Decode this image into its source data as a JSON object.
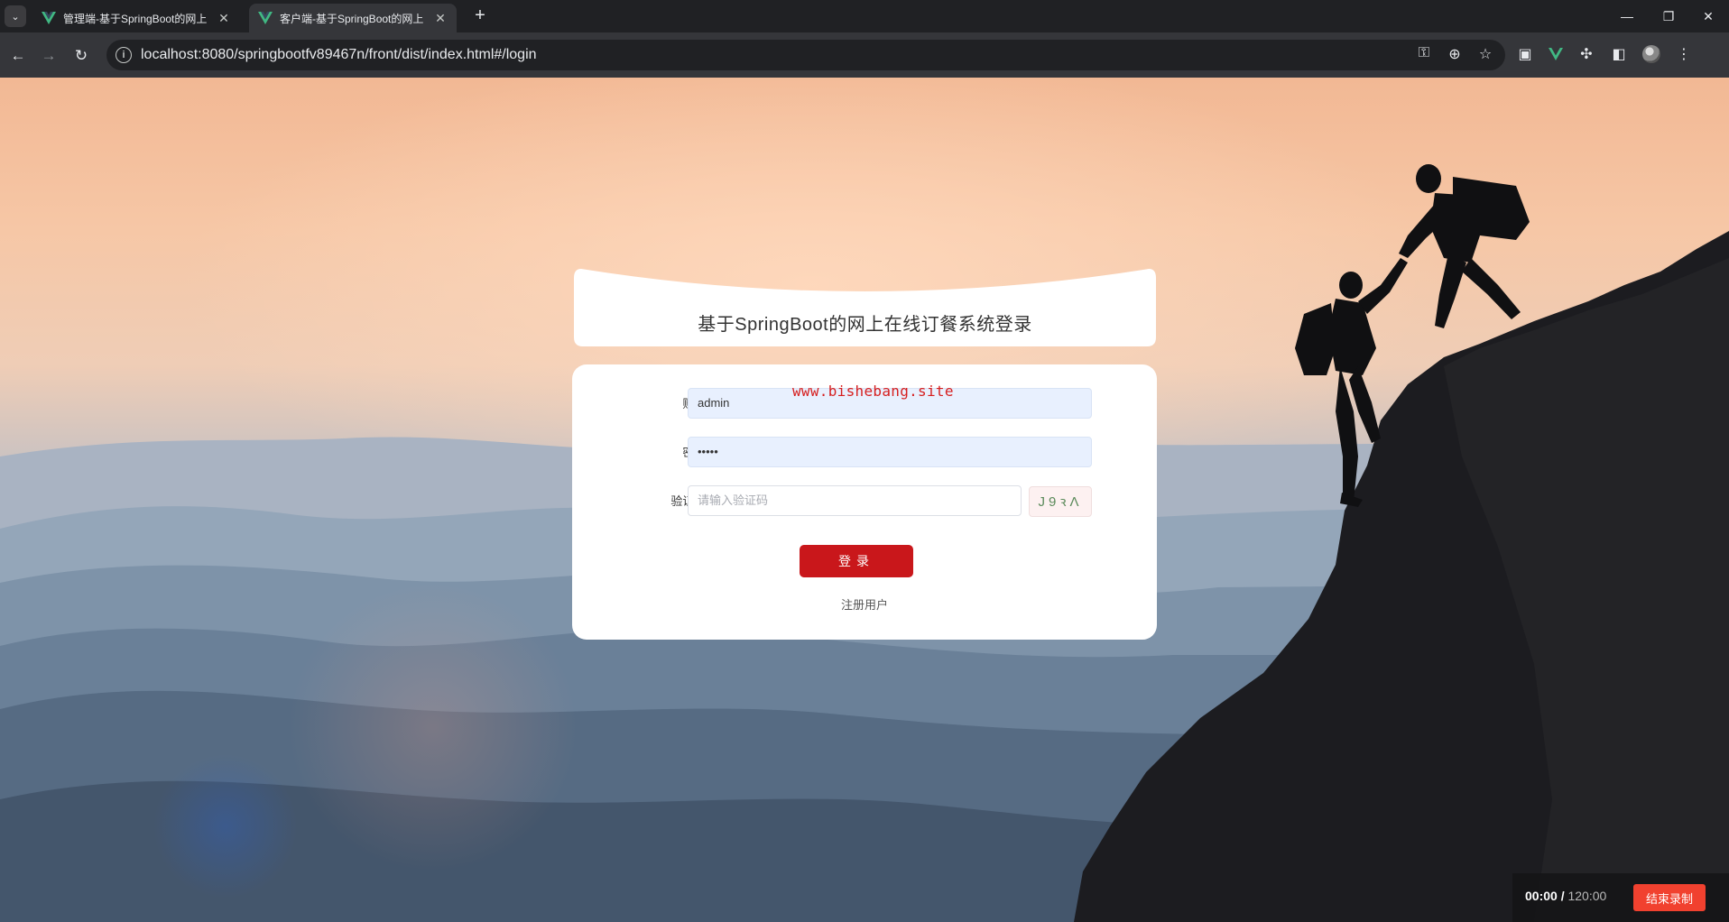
{
  "browser": {
    "tabs": [
      {
        "title": "管理端-基于SpringBoot的网上",
        "active": false
      },
      {
        "title": "客户端-基于SpringBoot的网上",
        "active": true
      }
    ],
    "new_tab_glyph": "+",
    "url_host": "localhost",
    "url_rest": ":8080/springbootfv89467n/front/dist/index.html#/login",
    "icons": {
      "tab_search": "chevron-down-icon",
      "back": "back-arrow-icon",
      "forward": "forward-arrow-icon",
      "reload": "reload-icon",
      "site_info": "info-icon",
      "password": "key-icon",
      "zoom": "zoom-icon",
      "bookmark": "star-icon"
    },
    "colors": {
      "chrome_bg": "#202124",
      "toolbar_bg": "#35363a",
      "vue_green": "#41b883"
    }
  },
  "login": {
    "title": "基于SpringBoot的网上在线订餐系统登录",
    "account_label": "账号:",
    "account_value": "admin",
    "password_label": "密码:",
    "password_value": "•••••",
    "captcha_label": "验证码:",
    "captcha_placeholder": "请输入验证码",
    "captcha_text": "J9ꝛΛ",
    "login_button": "登录",
    "register_link": "注册用户",
    "colors": {
      "button": "#c9171b",
      "card": "#ffffff",
      "input_filled": "#e8f0fe"
    }
  },
  "watermark": "www.bishebang.site",
  "recorder": {
    "current": "00:00",
    "separator": "/",
    "total": "120:00",
    "stop_label": "结束录制",
    "colors": {
      "stop": "#f1412f"
    }
  }
}
